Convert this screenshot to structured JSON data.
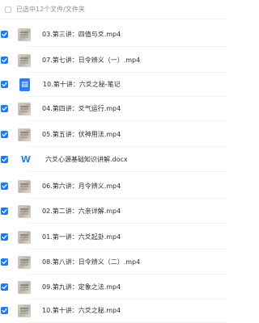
{
  "header": {
    "selected_text": "已选中12个文件/文件夹"
  },
  "files": [
    {
      "name": "03.第三讲：四值与爻.mp4",
      "type": "video"
    },
    {
      "name": "07.第七讲：日令辨义（一）.mp4",
      "type": "video"
    },
    {
      "name": "10.第十讲：六爻之秘-笔记",
      "type": "doc",
      "icon_text": "▤"
    },
    {
      "name": "04.第四讲：爻气运行.mp4",
      "type": "video"
    },
    {
      "name": "05.第五讲：伏神用法.mp4",
      "type": "video"
    },
    {
      "name": "六爻心源基础知识讲解.docx",
      "type": "wps",
      "icon_text": "W"
    },
    {
      "name": "06.第六讲：月令辨义.mp4",
      "type": "video"
    },
    {
      "name": "02.第二讲：六亲详解.mp4",
      "type": "video"
    },
    {
      "name": "01.第一讲：六爻起卦.mp4",
      "type": "video"
    },
    {
      "name": "08.第八讲：日令辨义（二）.mp4",
      "type": "video"
    },
    {
      "name": "09.第九讲：定象之法.mp4",
      "type": "video"
    },
    {
      "name": "10.第十讲：六爻之秘.mp4",
      "type": "video"
    }
  ]
}
